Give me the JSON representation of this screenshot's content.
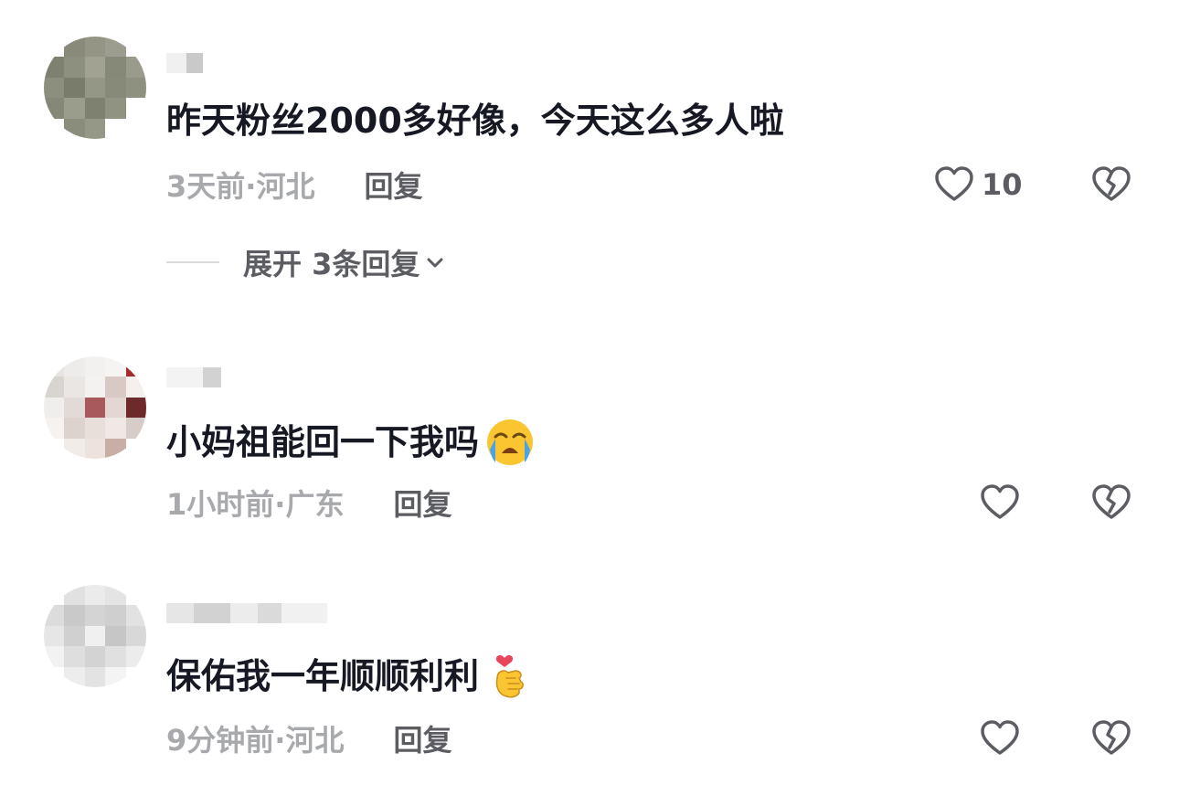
{
  "comments": [
    {
      "text": "昨天粉丝2000多好像，今天这么多人啦",
      "time": "3天前",
      "separator": " · ",
      "location": "河北",
      "reply_label": "回复",
      "like_count": "10",
      "expand_label": "展开 3条回复"
    },
    {
      "text": "小妈祖能回一下我吗",
      "emoji": "loudly-crying-face",
      "time": "1小时前",
      "separator": " · ",
      "location": "广东",
      "reply_label": "回复"
    },
    {
      "text": "保佑我一年顺顺利利",
      "emoji": "finger-heart-hand",
      "time": "9分钟前",
      "separator": " · ",
      "location": "河北",
      "reply_label": "回复"
    }
  ],
  "icons": {
    "like": "heart-outline-icon",
    "dislike": "broken-heart-icon",
    "expand": "chevron-down-icon"
  },
  "colors": {
    "text": "#161823",
    "meta": "#a8a9ad",
    "action": "#5c5d63",
    "icon": "#5c5d63"
  }
}
